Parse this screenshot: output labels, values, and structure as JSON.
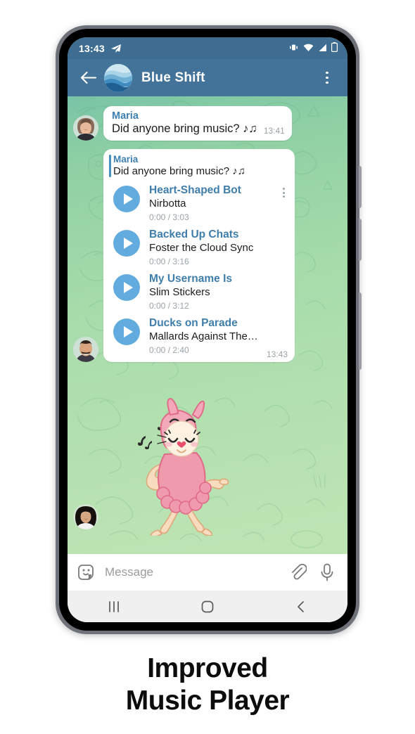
{
  "statusbar": {
    "time": "13:43",
    "nav_icon": "telegram-send-icon",
    "icons": [
      "vibrate-icon",
      "wifi-icon",
      "signal-icon",
      "battery-icon"
    ]
  },
  "header": {
    "back_icon": "back-arrow-icon",
    "avatar_name": "chat-avatar",
    "title": "Blue Shift",
    "menu_icon": "overflow-menu-icon"
  },
  "messages": {
    "first": {
      "avatar_name": "maria-avatar",
      "sender": "Maria",
      "text": "Did anyone bring music? ♪♫",
      "time": "13:41"
    },
    "music": {
      "avatar_name": "sender-avatar",
      "quoted": {
        "sender": "Maria",
        "text": "Did anyone bring music? ♪♫"
      },
      "tracks": [
        {
          "title": "Heart-Shaped Bot",
          "artist": "Nirbotta",
          "progress": "0:00 / 3:03",
          "has_menu": true
        },
        {
          "title": "Backed Up Chats",
          "artist": "Foster the Cloud Sync",
          "progress": "0:00 / 3:16",
          "has_menu": false
        },
        {
          "title": "My Username Is",
          "artist": "Slim Stickers",
          "progress": "0:00 / 3:12",
          "has_menu": false
        },
        {
          "title": "Ducks on Parade",
          "artist": "Mallards Against The…",
          "progress": "0:00 / 2:40",
          "has_menu": false
        }
      ],
      "time": "13:43"
    },
    "sticker": {
      "avatar_name": "sticker-sender-avatar",
      "description": "dancing-pink-llama-sticker"
    }
  },
  "input_bar": {
    "emoji_icon": "sticker-smiley-icon",
    "placeholder": "Message",
    "value": "",
    "attach_icon": "paperclip-icon",
    "mic_icon": "microphone-icon"
  },
  "navbar": {
    "recents_icon": "recents-icon",
    "home_icon": "home-icon",
    "back_icon": "back-icon"
  },
  "caption": {
    "line1": "Improved",
    "line2": "Music Player"
  },
  "colors": {
    "header": "#44739a",
    "statusbar": "#3f6d92",
    "accent_blue": "#3f7eab",
    "play_button": "#62abdf",
    "bubble": "#ffffff",
    "chat_bg_top": "#79c4a6",
    "chat_bg_bottom": "#bfe4b4"
  }
}
